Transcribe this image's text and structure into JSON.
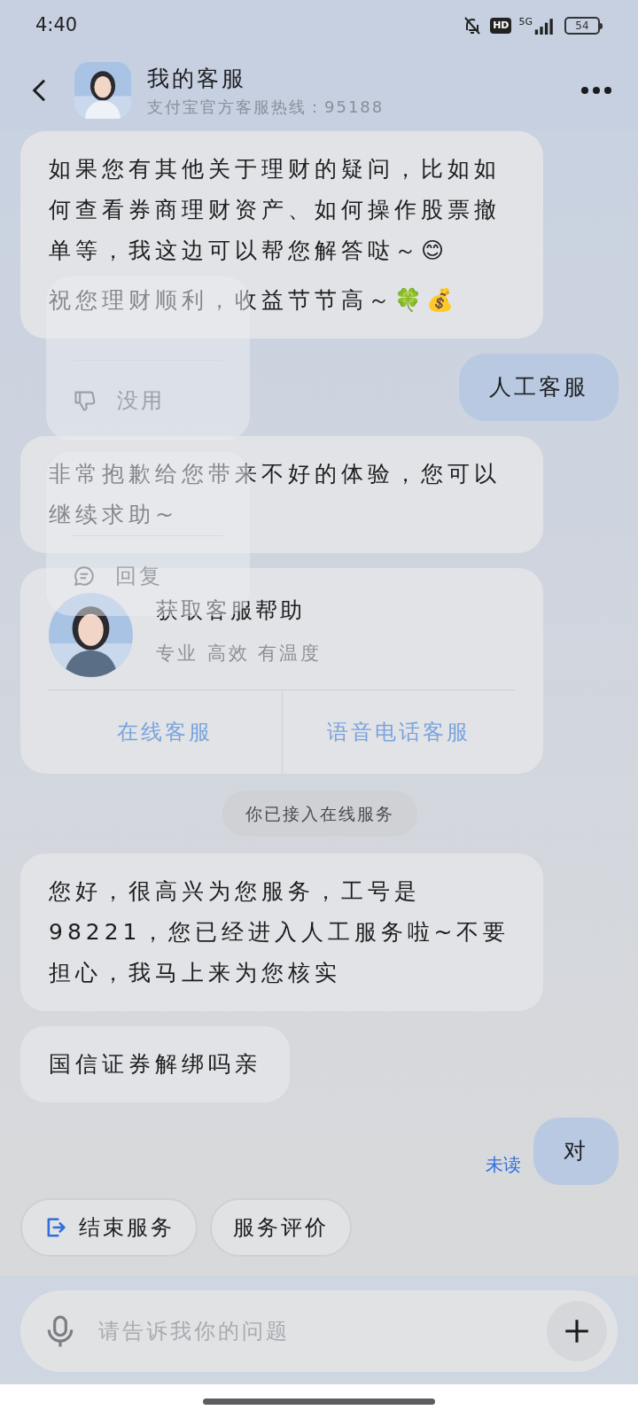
{
  "status_bar": {
    "time": "4:40",
    "hd": "HD",
    "network": "5G",
    "battery": "54"
  },
  "header": {
    "title": "我的客服",
    "subtitle": "支付宝官方客服热线：95188"
  },
  "messages": [
    {
      "kind": "bot",
      "paragraphs": [
        "如果您有其他关于理财的疑问，比如如何查看券商理财资产、如何操作股票撤单等，我这边可以帮您解答哒～😊",
        "祝您理财顺利，收益节节高～🍀💰"
      ]
    },
    {
      "kind": "user",
      "text": "人工客服"
    },
    {
      "kind": "bot",
      "paragraphs": [
        "非常抱歉给您带来不好的体验，您可以继续求助~"
      ]
    },
    {
      "kind": "card",
      "title": "获取客服帮助",
      "subtitle": "专业 高效 有温度",
      "actions": [
        "在线客服",
        "语音电话客服"
      ]
    },
    {
      "kind": "system",
      "text": "你已接入在线服务"
    },
    {
      "kind": "bot",
      "paragraphs": [
        "您好，很高兴为您服务，工号是98221，您已经进入人工服务啦~不要担心，我马上来为您核实"
      ]
    },
    {
      "kind": "bot",
      "paragraphs": [
        "国信证券解绑吗亲"
      ]
    },
    {
      "kind": "user",
      "text": "对",
      "read_status": "未读"
    }
  ],
  "context_menus": [
    {
      "items": [
        {
          "kind": "dislike",
          "label": "没用"
        }
      ]
    },
    {
      "items": [
        {
          "kind": "reply",
          "label": "回复"
        }
      ]
    }
  ],
  "quick_actions": [
    {
      "kind": "exit",
      "label": "结束服务"
    },
    {
      "kind": "plain",
      "label": "服务评价"
    }
  ],
  "input": {
    "placeholder": "请告诉我你的问题"
  }
}
